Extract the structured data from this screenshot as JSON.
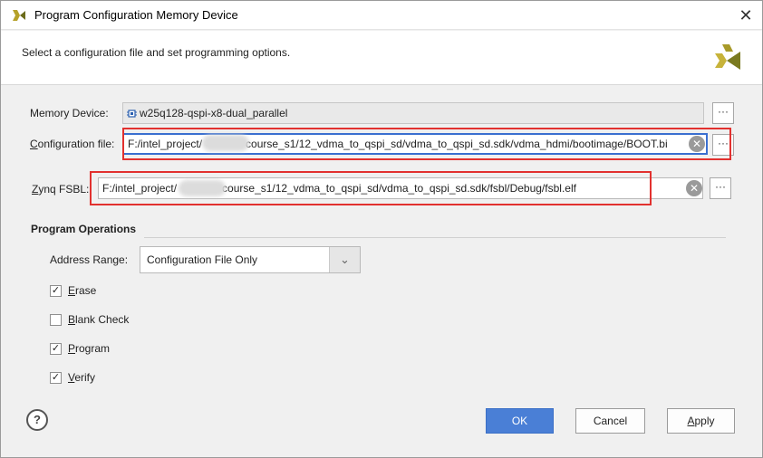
{
  "window": {
    "title": "Program Configuration Memory Device",
    "close_glyph": "✕"
  },
  "header": {
    "instruction": "Select a configuration file and set programming options."
  },
  "memory_device": {
    "label": "Memory Device:",
    "value": "w25q128-qspi-x8-dual_parallel",
    "browse_label": "···"
  },
  "configuration_file": {
    "label_prefix": "C",
    "label_rest": "onfiguration file:",
    "value_part1": "F:/intel_project/",
    "value_part2": "course_s1/12_vdma_to_qspi_sd/vdma_to_qspi_sd.sdk/vdma_hdmi/bootimage/BOOT.bi",
    "browse_label": "···"
  },
  "zynq_fsbl": {
    "label_prefix": "Z",
    "label_rest": "ynq FSBL:",
    "value_part1": "F:/intel_project/",
    "value_part2": "course_s1/12_vdma_to_qspi_sd/vdma_to_qspi_sd.sdk/fsbl/Debug/fsbl.elf",
    "browse_label": "···"
  },
  "program_operations": {
    "title": "Program Operations",
    "address_range_label": "Address Range:",
    "address_range_value": "Configuration File Only",
    "options": [
      {
        "prefix": "E",
        "rest": "rase",
        "checked": true
      },
      {
        "prefix": "B",
        "rest": "lank Check",
        "checked": false
      },
      {
        "prefix": "P",
        "rest": "rogram",
        "checked": true
      },
      {
        "prefix": "V",
        "rest": "erify",
        "checked": true
      }
    ]
  },
  "footer": {
    "help_label": "?",
    "ok_label": "OK",
    "cancel_label": "Cancel",
    "apply_prefix": "A",
    "apply_rest": "pply"
  },
  "colors": {
    "accent_blue": "#4a7fd6",
    "highlight_red": "#e2312f"
  }
}
